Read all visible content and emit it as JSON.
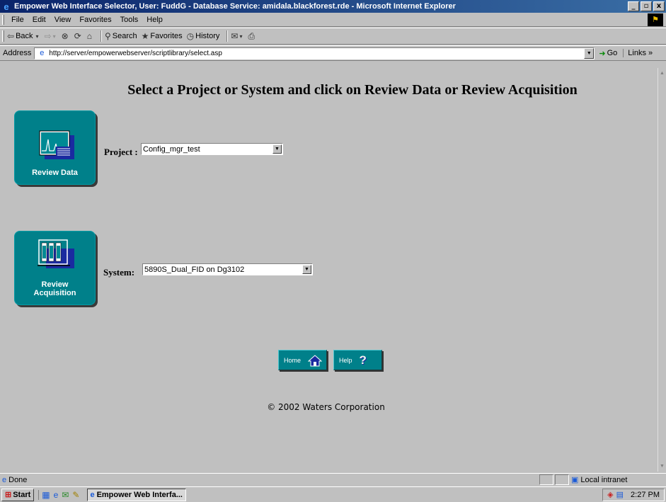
{
  "window": {
    "title": "Empower Web Interface Selector, User: FuddG - Database Service: amidala.blackforest.rde - Microsoft Internet Explorer",
    "min": "_",
    "max": "▫",
    "close": "x"
  },
  "menu": [
    "File",
    "Edit",
    "View",
    "Favorites",
    "Tools",
    "Help"
  ],
  "toolbar": {
    "back": "Back",
    "search": "Search",
    "favorites": "Favorites",
    "history": "History"
  },
  "address": {
    "label": "Address",
    "url": "http://server/empowerwebserver/scriptlibrary/select.asp",
    "go": "Go",
    "links": "Links »"
  },
  "page": {
    "heading": "Select a Project or System and click on Review Data or Review Acquisition",
    "review_data_label": "Review Data",
    "review_acq_label_1": "Review",
    "review_acq_label_2": "Acquisition",
    "project_label": "Project :",
    "project_value": "Config_mgr_test",
    "system_label": "System:",
    "system_value": "5890S_Dual_FID on Dg3102",
    "home_label": "Home",
    "help_label": "Help",
    "copyright": "© 2002 Waters Corporation"
  },
  "status": {
    "text": "Done",
    "zone": "Local intranet"
  },
  "taskbar": {
    "start": "Start",
    "task": "Empower Web Interfa...",
    "time": "2:27 PM"
  },
  "colors": {
    "tile": "#00808a",
    "titlebar": "#0a246a"
  }
}
